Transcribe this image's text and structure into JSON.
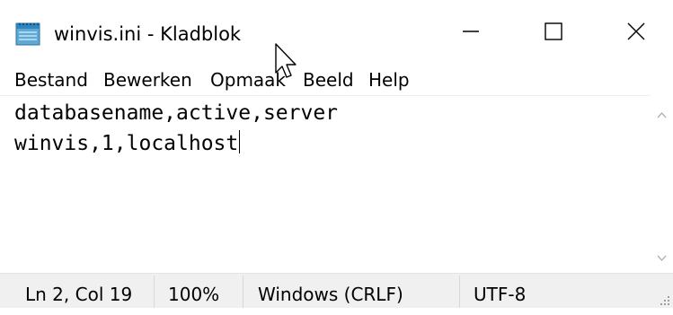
{
  "window": {
    "title": "winvis.ini - Kladblok",
    "app_icon": "notepad-icon",
    "controls": {
      "minimize_icon": "minimize-icon",
      "maximize_icon": "maximize-icon",
      "close_icon": "close-icon"
    }
  },
  "menu": {
    "items": [
      {
        "label": "Bestand"
      },
      {
        "label": "Bewerken"
      },
      {
        "label": "Opmaak"
      },
      {
        "label": "Beeld"
      },
      {
        "label": "Help"
      }
    ]
  },
  "editor": {
    "lines": [
      "databasename,active,server",
      "winvis,1,localhost"
    ]
  },
  "status": {
    "position": "Ln 2, Col 19",
    "zoom": "100%",
    "line_ending": "Windows (CRLF)",
    "encoding": "UTF-8"
  },
  "colors": {
    "status_bg": "#f0f0f0",
    "text": "#000000"
  }
}
